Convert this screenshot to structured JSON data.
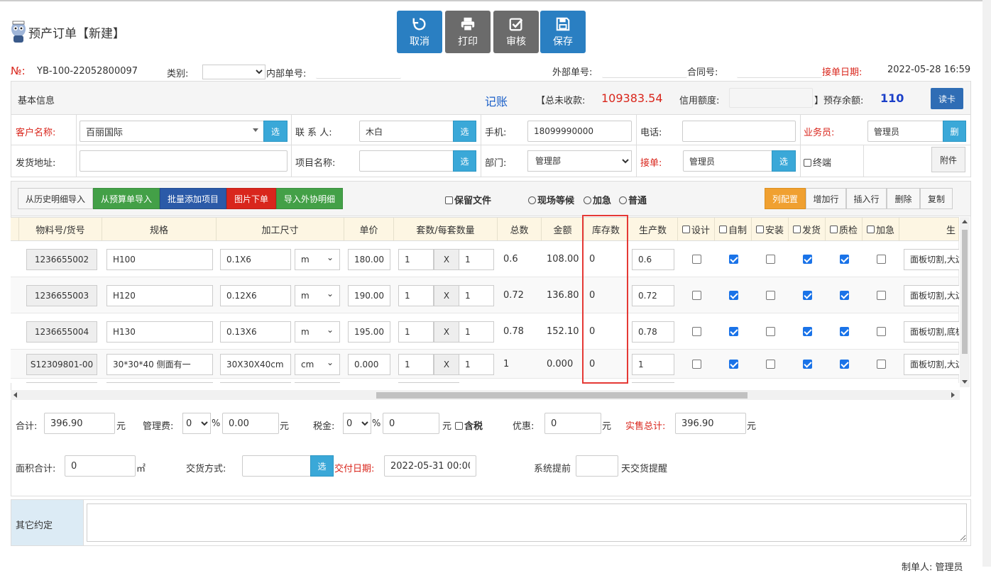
{
  "header": {
    "title": "预产订单【新建】",
    "buttons": {
      "cancel": "取消",
      "print": "打印",
      "audit": "审核",
      "save": "保存"
    }
  },
  "order": {
    "no_label": "№:",
    "no_value": "YB-100-22052800097",
    "category_label": "类别:",
    "internal_no_label": "内部单号:",
    "external_no_label": "外部单号:",
    "contract_no_label": "合同号:",
    "receive_date_label": "接单日期:",
    "receive_date_value": "2022-05-28 16:59"
  },
  "basic": {
    "title": "基本信息",
    "account": "记账",
    "total_unpaid_label": "【总未收款:",
    "total_unpaid_value": "109383.54",
    "credit_label": "信用额度:",
    "balance_label": "】预存余额:",
    "balance_value": "110",
    "read_card": "读卡",
    "customer_label": "客户名称:",
    "customer_value": "百丽国际",
    "contact_label": "联 系 人:",
    "contact_value": "木白",
    "mobile_label": "手机:",
    "mobile_value": "18099990000",
    "phone_label": "电话:",
    "salesman_label": "业务员:",
    "salesman_value": "管理员",
    "delete_short": "删",
    "address_label": "发货地址:",
    "project_label": "项目名称:",
    "dept_label": "部门:",
    "dept_value": "管理部",
    "receiver_label": "接单:",
    "receiver_value": "管理员",
    "terminal_label": "终端",
    "attachment": "附件",
    "select_short": "选"
  },
  "toolbar": {
    "history_import": "从历史明细导入",
    "budget_import": "从预算单导入",
    "batch_add": "批量添加项目",
    "image_order": "图片下单",
    "outsource_import": "导入外协明细",
    "keep_file": "保留文件",
    "onsite_wait": "现场等候",
    "urgent": "加急",
    "normal": "普通",
    "col_config": "列配置",
    "add_row": "增加行",
    "insert_row": "插入行",
    "delete": "删除",
    "copy": "复制"
  },
  "grid": {
    "headers": {
      "material": "物料号/货号",
      "spec": "规格",
      "size": "加工尺寸",
      "price": "单价",
      "sets": "套数/每套数量",
      "total": "总数",
      "amount": "金额",
      "stock": "库存数",
      "production": "生产数",
      "design": "设计",
      "selfmade": "自制",
      "install": "安装",
      "ship": "发货",
      "qc": "质检",
      "urgent": "加急",
      "process": "生"
    },
    "rows": [
      {
        "material": "1236655002",
        "spec": "H100",
        "size": "0.1X6",
        "unit": "m",
        "price": "180.00",
        "sets": "1",
        "x": "X",
        "per": "1",
        "total": "0.6",
        "amount": "108.00",
        "stock": "0",
        "production": "0.6",
        "design": false,
        "selfmade": true,
        "install": false,
        "ship": true,
        "qc": true,
        "urgent": false,
        "process": "面板切割,大边"
      },
      {
        "material": "1236655003",
        "spec": "H120",
        "size": "0.12X6",
        "unit": "m",
        "price": "190.00",
        "sets": "1",
        "x": "X",
        "per": "1",
        "total": "0.72",
        "amount": "136.80",
        "stock": "0",
        "production": "0.72",
        "design": false,
        "selfmade": true,
        "install": false,
        "ship": true,
        "qc": true,
        "urgent": false,
        "process": "面板切割,大边"
      },
      {
        "material": "1236655004",
        "spec": "H130",
        "size": "0.13X6",
        "unit": "m",
        "price": "195.00",
        "sets": "1",
        "x": "X",
        "per": "1",
        "total": "0.78",
        "amount": "152.10",
        "stock": "0",
        "production": "0.78",
        "design": false,
        "selfmade": true,
        "install": false,
        "ship": true,
        "qc": true,
        "urgent": false,
        "process": "面板切割,底板"
      },
      {
        "material": "S12309801-00",
        "spec": "30*30*40 侧面有一",
        "size": "30X30X40cm",
        "unit": "cm",
        "price": "0.000",
        "sets": "1",
        "x": "X",
        "per": "1",
        "total": "1",
        "amount": "0.000",
        "stock": "0",
        "production": "1",
        "design": false,
        "selfmade": true,
        "install": false,
        "ship": true,
        "qc": true,
        "urgent": false,
        "process": "面板切割,大边"
      }
    ]
  },
  "summary": {
    "total_label": "合计:",
    "total_value": "396.90",
    "yuan": "元",
    "mgmt_label": "管理费:",
    "mgmt_pct": "0",
    "mgmt_value": "0.00",
    "percent": "%",
    "tax_label": "税金:",
    "tax_pct": "0",
    "tax_value": "0",
    "tax_incl": "含税",
    "discount_label": "优惠:",
    "discount_value": "0",
    "actual_label": "实售总计:",
    "actual_value": "396.90",
    "area_label": "面积合计:",
    "area_value": "0",
    "area_unit": "㎡",
    "delivery_label": "交货方式:",
    "delivery_date_label": "交付日期:",
    "delivery_date_value": "2022-05-31 00:00",
    "remind_label": "系统提前",
    "remind_suffix": "天交货提醒",
    "other_label": "其它约定",
    "maker": "制单人: 管理员"
  },
  "colors": {
    "primary": "#2a7fc2",
    "green": "#43a047",
    "red": "#d9261c",
    "orange": "#f0a030"
  }
}
